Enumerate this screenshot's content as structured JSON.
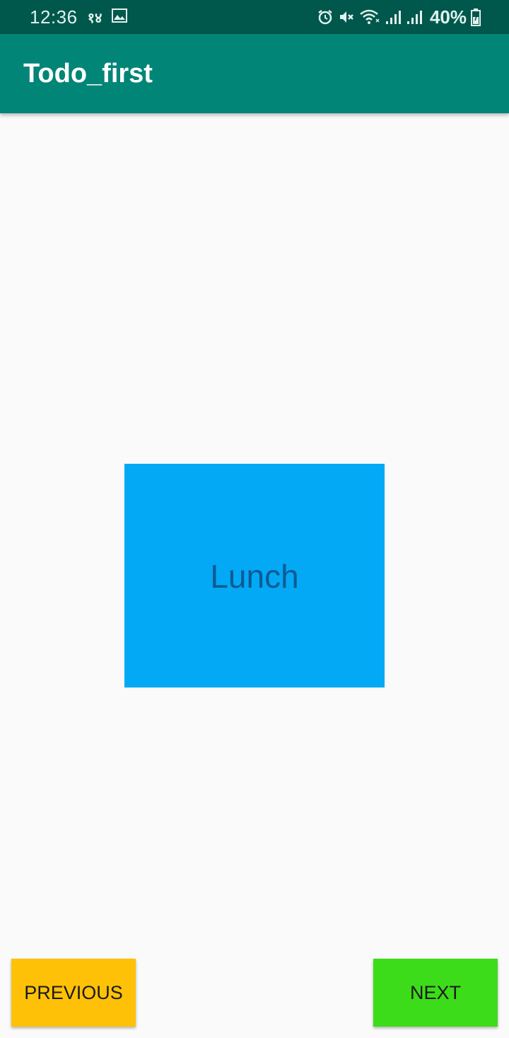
{
  "status_bar": {
    "time": "12:36",
    "indicator": "१४",
    "battery": "40%",
    "icons": [
      "image-icon",
      "alarm-icon",
      "mute-icon",
      "wifi-icon",
      "signal-icon",
      "signal-icon",
      "battery-icon"
    ]
  },
  "app_bar": {
    "title": "Todo_first"
  },
  "todo": {
    "label": "Lunch",
    "color": "#03a9f4"
  },
  "buttons": {
    "previous": "PREVIOUS",
    "next": "NEXT"
  },
  "colors": {
    "status_bar": "#00574b",
    "app_bar": "#008577",
    "previous": "#ffc107",
    "next": "#3ddc1a"
  }
}
